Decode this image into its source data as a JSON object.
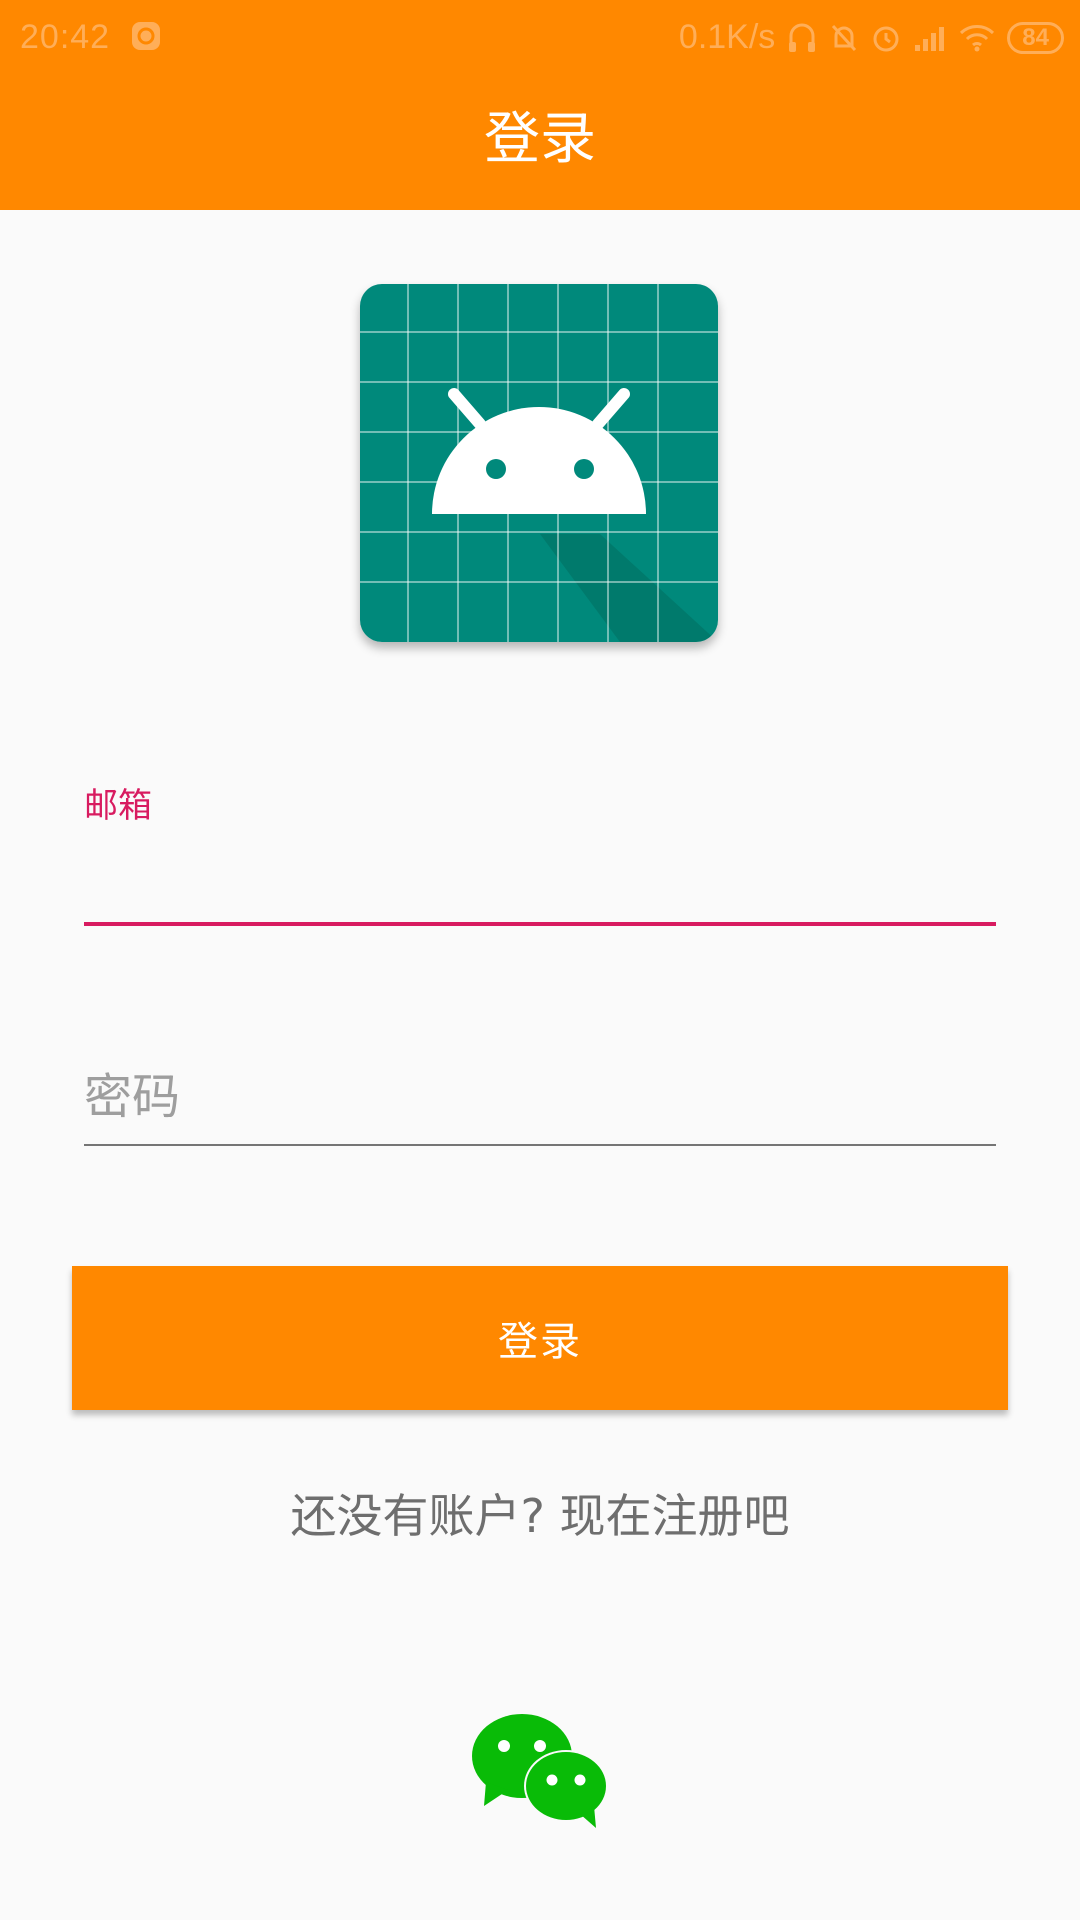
{
  "status_bar": {
    "time": "20:42",
    "network_speed": "0.1K/s",
    "battery": "84"
  },
  "app_bar": {
    "title": "登录"
  },
  "form": {
    "email_label": "邮箱",
    "email_value": "",
    "password_placeholder": "密码",
    "password_value": ""
  },
  "login_button_label": "登录",
  "register_link": "还没有账户? 现在注册吧",
  "colors": {
    "accent": "#ff8800",
    "focus": "#d81b60",
    "logo_bg": "#00897b",
    "wechat": "#09bb07"
  }
}
